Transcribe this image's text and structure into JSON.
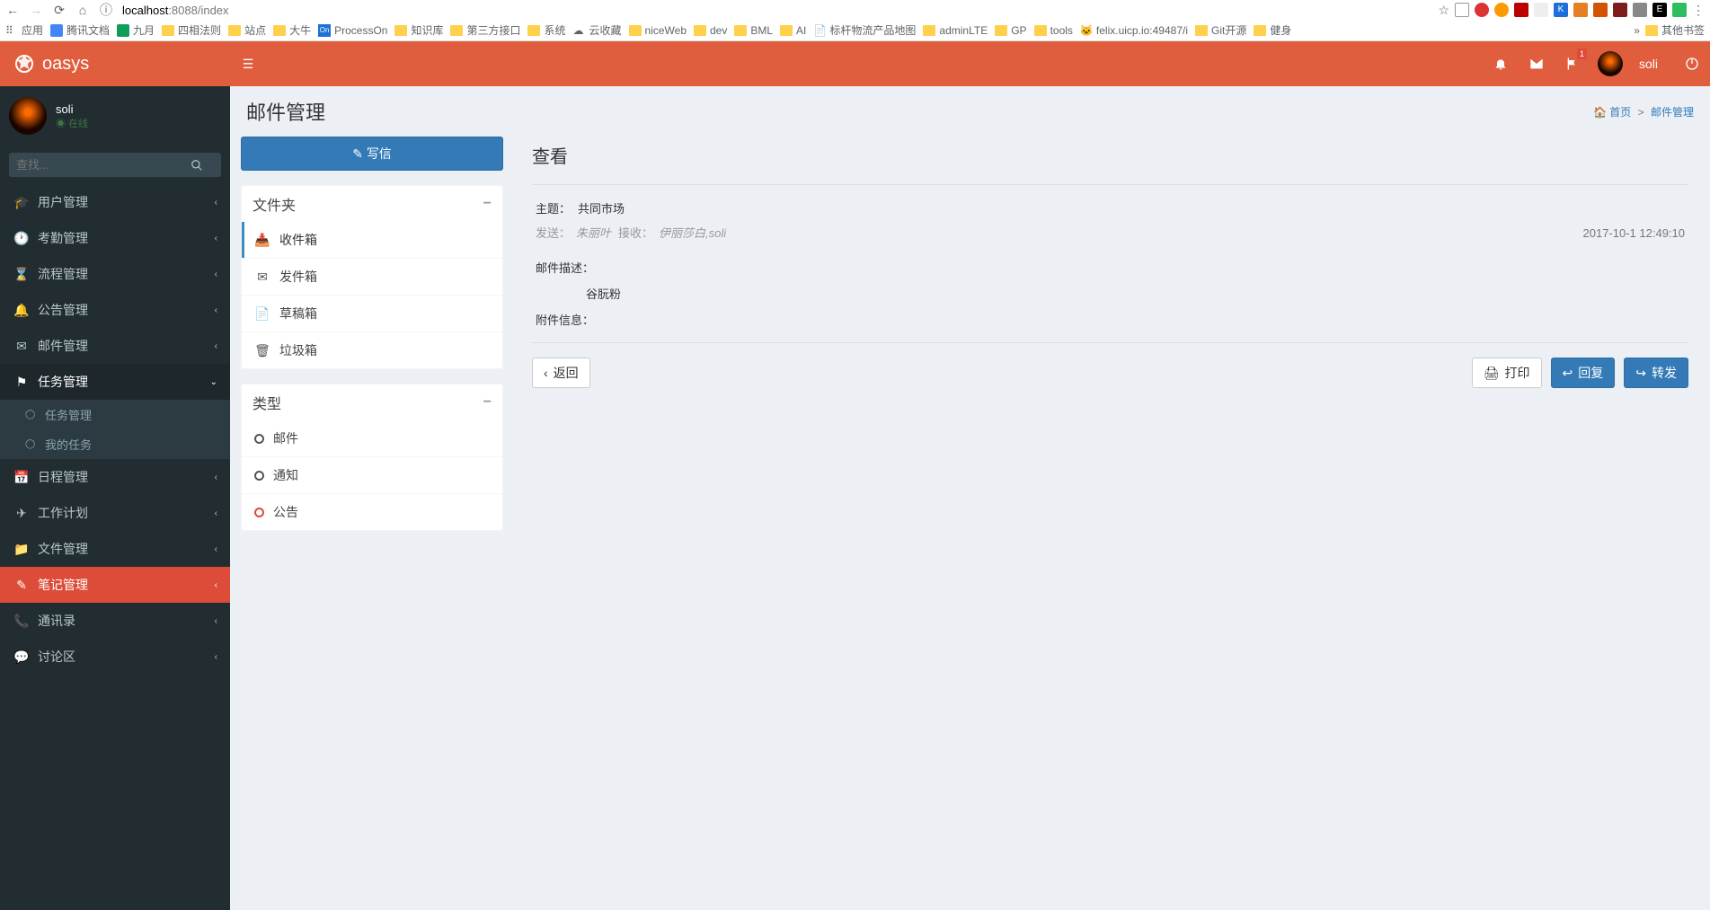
{
  "browser": {
    "url_prefix": "localhost",
    "url_suffix": ":8088/index",
    "bookmarks": [
      "应用",
      "腾讯文档",
      "九月",
      "四相法则",
      "站点",
      "大牛",
      "ProcessOn",
      "知识库",
      "第三方接口",
      "系统",
      "云收藏",
      "niceWeb",
      "dev",
      "BML",
      "AI",
      "标杆物流产品地图",
      "adminLTE",
      "GP",
      "tools",
      "felix.uicp.io:49487/i",
      "Git开源",
      "健身"
    ],
    "bookmarks_more": "其他书签"
  },
  "header": {
    "brand": "oasys",
    "username": "soli",
    "flag_badge": "1"
  },
  "sidebar_user": {
    "name": "soli",
    "status": "在线"
  },
  "search": {
    "placeholder": "查找..."
  },
  "menu": {
    "items": [
      {
        "icon": "graduation",
        "label": "用户管理"
      },
      {
        "icon": "clock",
        "label": "考勤管理"
      },
      {
        "icon": "hourglass",
        "label": "流程管理"
      },
      {
        "icon": "bell",
        "label": "公告管理"
      },
      {
        "icon": "envelope",
        "label": "邮件管理"
      },
      {
        "icon": "flag",
        "label": "任务管理",
        "open": true,
        "children": [
          {
            "label": "任务管理"
          },
          {
            "label": "我的任务"
          }
        ]
      },
      {
        "icon": "calendar",
        "label": "日程管理"
      },
      {
        "icon": "plane",
        "label": "工作计划"
      },
      {
        "icon": "folder",
        "label": "文件管理"
      },
      {
        "icon": "edit",
        "label": "笔记管理",
        "active": true
      },
      {
        "icon": "phone",
        "label": "通讯录"
      },
      {
        "icon": "comment",
        "label": "讨论区"
      }
    ]
  },
  "page": {
    "title": "邮件管理",
    "breadcrumb_home": "首页",
    "breadcrumb_current": "邮件管理"
  },
  "compose": {
    "label": "写信"
  },
  "folders": {
    "title": "文件夹",
    "items": [
      {
        "icon": "inbox",
        "label": "收件箱",
        "active": true
      },
      {
        "icon": "envelope",
        "label": "发件箱"
      },
      {
        "icon": "file",
        "label": "草稿箱"
      },
      {
        "icon": "trash",
        "label": "垃圾箱"
      }
    ]
  },
  "types": {
    "title": "类型",
    "items": [
      {
        "color": "dark",
        "label": "邮件"
      },
      {
        "color": "dark",
        "label": "通知"
      },
      {
        "color": "red",
        "label": "公告"
      }
    ]
  },
  "view": {
    "title": "查看",
    "subject_label": "主题：",
    "subject": "共同市场",
    "send_label": "发送：",
    "sender": "朱丽叶",
    "recv_label": "接收：",
    "recipients": "伊丽莎白,soli",
    "timestamp": "2017-10-1 12:49:10",
    "desc_label": "邮件描述：",
    "desc_body": "谷朊粉",
    "attach_label": "附件信息："
  },
  "actions": {
    "back": "返回",
    "print": "打印",
    "reply": "回复",
    "forward": "转发"
  }
}
